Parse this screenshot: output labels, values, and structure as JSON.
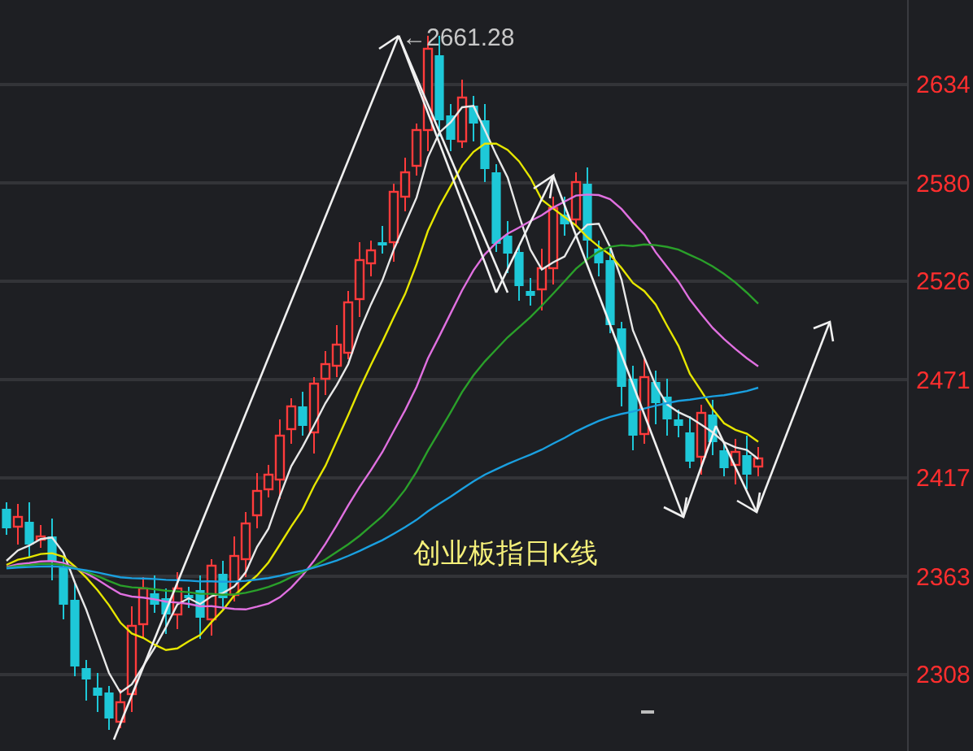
{
  "chart": {
    "title": "创业板指日K线",
    "peak_label": "←2661.28",
    "y_axis_labels": [
      "2634",
      "2580",
      "2526",
      "2471",
      "2417",
      "2363",
      "2308"
    ]
  }
}
